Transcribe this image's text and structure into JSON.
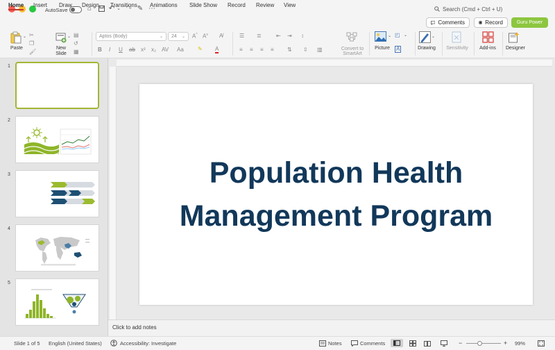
{
  "titlebar": {
    "autosave_label": "AutoSave",
    "search_placeholder": "Search (Cmd + Ctrl + U)"
  },
  "tabs": [
    "Home",
    "Insert",
    "Draw",
    "Design",
    "Transitions",
    "Animations",
    "Slide Show",
    "Record",
    "Review",
    "View"
  ],
  "top_buttons": {
    "comments": "Comments",
    "record": "Record",
    "guru": "Guru Power"
  },
  "ribbon": {
    "paste": "Paste",
    "new_slide_1": "New",
    "new_slide_2": "Slide",
    "font_name": "Aptos (Body)",
    "font_size": "24",
    "convert_1": "Convert to",
    "convert_2": "SmartArt",
    "picture": "Picture",
    "drawing": "Drawing",
    "sensitivity": "Sensitivity",
    "addins": "Add-ins",
    "designer": "Designer"
  },
  "slides": {
    "numbers": [
      "1",
      "2",
      "3",
      "4",
      "5"
    ],
    "current_title": "Population Health Management Program"
  },
  "notes_placeholder": "Click to add notes",
  "status": {
    "slide_of": "Slide 1 of 5",
    "language": "English (United States)",
    "accessibility": "Accessibility: Investigate",
    "notes": "Notes",
    "comments": "Comments",
    "zoom": "99%"
  },
  "colors": {
    "accent_red": "#c0392b",
    "brand_green": "#8dc63f",
    "title_navy": "#12385a",
    "selection_olive": "#a4b632"
  }
}
